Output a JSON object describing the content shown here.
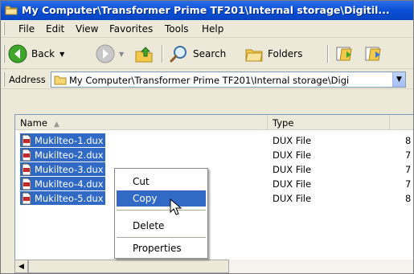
{
  "window": {
    "title": "My Computer\\Transformer Prime TF201\\Internal storage\\Digitil..."
  },
  "menu": [
    "File",
    "Edit",
    "View",
    "Favorites",
    "Tools",
    "Help"
  ],
  "toolbar": {
    "back_label": "Back",
    "search_label": "Search",
    "folders_label": "Folders"
  },
  "address": {
    "label": "Address",
    "value": "My Computer\\Transformer Prime TF201\\Internal storage\\Digi"
  },
  "columns": {
    "name": "Name",
    "type": "Type"
  },
  "files": [
    {
      "name": "Mukilteo-1.dux",
      "type": "DUX File",
      "size": "8"
    },
    {
      "name": "Mukilteo-2.dux",
      "type": "DUX File",
      "size": "7"
    },
    {
      "name": "Mukilteo-3.dux",
      "type": "DUX File",
      "size": "7"
    },
    {
      "name": "Mukilteo-4.dux",
      "type": "DUX File",
      "size": "7"
    },
    {
      "name": "Mukilteo-5.dux",
      "type": "DUX File",
      "size": "8"
    }
  ],
  "context_menu": {
    "items": [
      "Cut",
      "Copy",
      "Delete",
      "Properties"
    ],
    "highlighted": "Copy"
  },
  "colors": {
    "selection": "#316ac5",
    "titlebar": "#0a4fd6"
  }
}
